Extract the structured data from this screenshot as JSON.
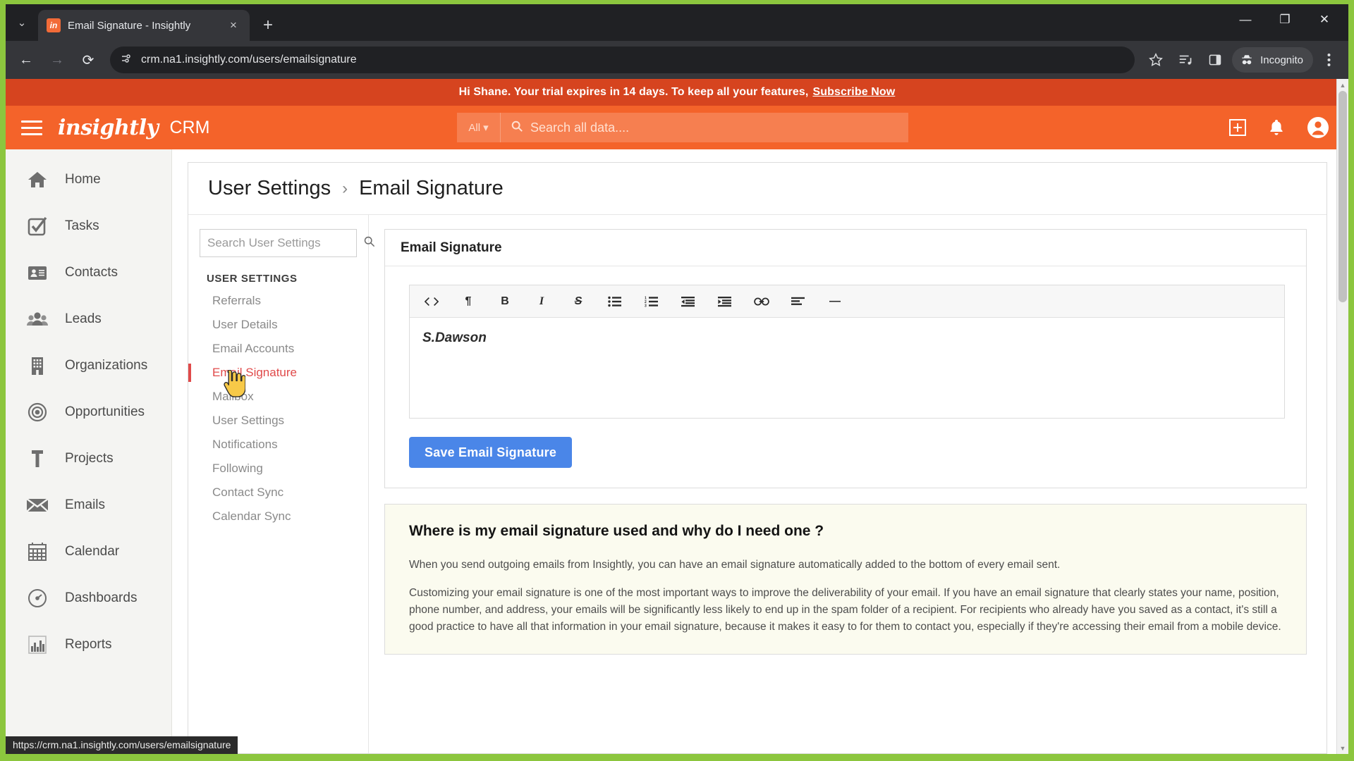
{
  "browser": {
    "tab": {
      "title": "Email Signature - Insightly",
      "favicon_text": "in"
    },
    "new_tab_label": "+",
    "close_label": "×",
    "tab_list_chevron": "⌄",
    "url": "crm.na1.insightly.com/users/emailsignature",
    "profile_label": "Incognito",
    "window_minimize": "—",
    "window_restore": "❐",
    "window_close": "✕",
    "back": "←",
    "forward": "→",
    "reload": "⟳",
    "status_url": "https://crm.na1.insightly.com/users/emailsignature"
  },
  "banner": {
    "text": "Hi Shane. Your trial expires in 14 days. To keep all your features,",
    "link": "Subscribe Now",
    "bg": "#d6441f"
  },
  "appheader": {
    "logo": "insightly",
    "product": "CRM",
    "search_scope": "All",
    "search_placeholder": "Search all data....",
    "search_value": "",
    "bg": "#f4632a",
    "icons": [
      "add-icon",
      "bell-icon",
      "account-icon"
    ]
  },
  "leftnav": {
    "items": [
      {
        "label": "Home",
        "icon": "home-icon"
      },
      {
        "label": "Tasks",
        "icon": "task-checkbox-icon"
      },
      {
        "label": "Contacts",
        "icon": "contact-card-icon"
      },
      {
        "label": "Leads",
        "icon": "people-icon"
      },
      {
        "label": "Organizations",
        "icon": "building-icon"
      },
      {
        "label": "Opportunities",
        "icon": "target-icon"
      },
      {
        "label": "Projects",
        "icon": "hammer-icon"
      },
      {
        "label": "Emails",
        "icon": "envelope-icon"
      },
      {
        "label": "Calendar",
        "icon": "calendar-icon"
      },
      {
        "label": "Dashboards",
        "icon": "gauge-icon"
      },
      {
        "label": "Reports",
        "icon": "bar-chart-icon"
      }
    ]
  },
  "breadcrumb": {
    "parent": "User Settings",
    "separator": "›",
    "current": "Email Signature"
  },
  "submenu": {
    "search_placeholder": "Search User Settings",
    "search_value": "",
    "heading": "USER SETTINGS",
    "items": [
      {
        "label": "Referrals",
        "active": false
      },
      {
        "label": "User Details",
        "active": false
      },
      {
        "label": "Email Accounts",
        "active": false
      },
      {
        "label": "Email Signature",
        "active": true
      },
      {
        "label": "Mailbox",
        "active": false
      },
      {
        "label": "User Settings",
        "active": false
      },
      {
        "label": "Notifications",
        "active": false
      },
      {
        "label": "Following",
        "active": false
      },
      {
        "label": "Contact Sync",
        "active": false
      },
      {
        "label": "Calendar Sync",
        "active": false
      }
    ],
    "active_color": "#e04a4a"
  },
  "signature_panel": {
    "title": "Email Signature",
    "toolbar": [
      {
        "name": "source-code-icon",
        "glyph": "<>"
      },
      {
        "name": "paragraph-icon",
        "glyph": "¶"
      },
      {
        "name": "bold-icon",
        "glyph": "B"
      },
      {
        "name": "italic-icon",
        "glyph": "I"
      },
      {
        "name": "strikethrough-icon",
        "glyph": "S"
      },
      {
        "name": "bullet-list-icon",
        "glyph": "☰"
      },
      {
        "name": "numbered-list-icon",
        "glyph": "☰"
      },
      {
        "name": "outdent-icon",
        "glyph": "☰"
      },
      {
        "name": "indent-icon",
        "glyph": "☰"
      },
      {
        "name": "link-icon",
        "glyph": "⚭"
      },
      {
        "name": "align-left-icon",
        "glyph": "☰"
      },
      {
        "name": "horizontal-rule-icon",
        "glyph": "—"
      }
    ],
    "editor_value": "S.Dawson",
    "save_label": "Save Email Signature",
    "save_color": "#4a86e8"
  },
  "help_panel": {
    "title": "Where is my email signature used and why do I need one ?",
    "paragraphs": [
      "When you send outgoing emails from Insightly, you can have an email signature automatically added to the bottom of every email sent.",
      "Customizing your email signature is one of the most important ways to improve the deliverability of your email. If you have an email signature that clearly states your name, position, phone number, and address, your emails will be significantly less likely to end up in the spam folder of a recipient. For recipients who already have you saved as a contact, it's still a good practice to have all that information in your email signature, because it makes it easy to for them to contact you, especially if they're accessing their email from a mobile device."
    ],
    "bg": "#fbfbef"
  },
  "scrollbar": {
    "up": "▲",
    "down": "▼"
  }
}
